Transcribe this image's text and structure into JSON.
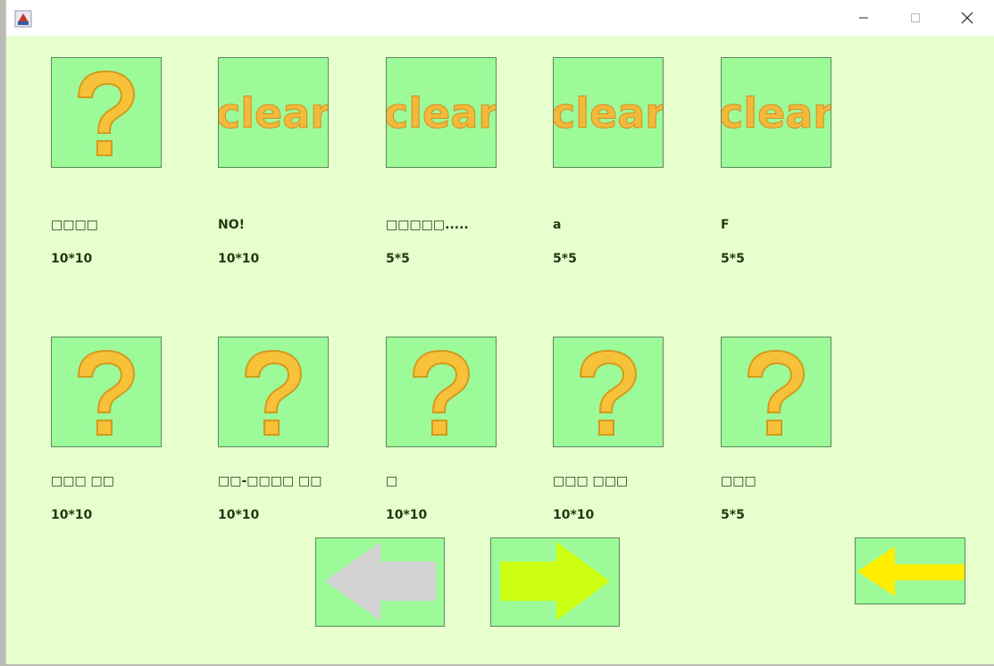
{
  "window": {
    "controls": {
      "minimize": "minimize-icon",
      "maximize": "maximize-icon",
      "close": "close-icon"
    }
  },
  "clear_text": "clear",
  "levels": [
    {
      "icon": "question-mark-icon",
      "name": "□□□□",
      "size": "10*10"
    },
    {
      "icon": "clear-icon",
      "name": "NO!",
      "size": "10*10"
    },
    {
      "icon": "clear-icon",
      "name": "□□□□□.....",
      "size": "5*5"
    },
    {
      "icon": "clear-icon",
      "name": "a",
      "size": "5*5"
    },
    {
      "icon": "clear-icon",
      "name": "F",
      "size": "5*5"
    },
    {
      "icon": "question-mark-icon",
      "name": "□□□ □□",
      "size": "10*10"
    },
    {
      "icon": "question-mark-icon",
      "name": "□□-□□□□ □□",
      "size": "10*10"
    },
    {
      "icon": "question-mark-icon",
      "name": "□",
      "size": "10*10"
    },
    {
      "icon": "question-mark-icon",
      "name": "□□□ □□□",
      "size": "10*10"
    },
    {
      "icon": "question-mark-icon",
      "name": "□□□",
      "size": "5*5"
    }
  ],
  "navigation": {
    "prev": {
      "icon": "arrow-left-icon",
      "color": "#d3d3d3"
    },
    "next": {
      "icon": "arrow-right-icon",
      "color": "#ccff12"
    },
    "back": {
      "icon": "back-arrow-icon",
      "color": "#ffee00"
    }
  },
  "colors": {
    "background": "#e6ffcd",
    "tile": "#9cfa99",
    "text": "#1e3a13",
    "icon_gold": "#f7c23a"
  }
}
